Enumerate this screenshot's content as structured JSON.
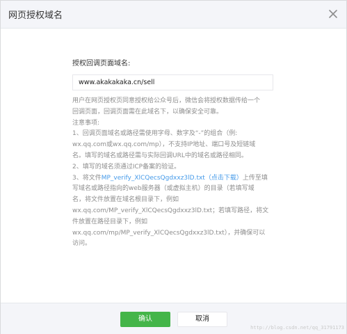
{
  "dialog": {
    "title": "网页授权域名"
  },
  "field": {
    "label": "授权回调页面域名:",
    "value": "www.akakakaka.cn/sell"
  },
  "tips": {
    "line1": "用户在网页授权页同意授权给公众号后，微信会将授权数据传给一个",
    "line2": "回调页面，回调页面需在此域名下，以确保安全可靠。",
    "line3": "注意事项:",
    "line4": "1、回调页面域名或路径需使用字母、数字及“-”的组合（例:",
    "line5": "wx.qq.com或wx.qq.com/mp），不支持IP地址、端口号及短链域",
    "line6": "名。填写的域名或路径需与实际回调URL中的域名或路径相同。",
    "line7": "2、填写的域名须通过ICP备案的验证。",
    "line8_prefix": "3、将文件",
    "line8_file_link": "MP_verify_XlCQecsQgdxxz3lD.txt",
    "line8_download_link": "（点击下载）",
    "line8_suffix": "上传至填",
    "line9": "写域名或路径指向的web服务器（或虚拟主机）的目录（若填写域",
    "line10": "名，将文件放置在域名根目录下，例如",
    "line11": "wx.qq.com/MP_verify_XlCQecsQgdxxz3lD.txt；若填写路径，将文",
    "line12": "件放置在路径目录下，例如",
    "line13": "wx.qq.com/mp/MP_verify_XlCQecsQgdxxz3lD.txt），并确保可以",
    "line14": "访问。"
  },
  "footer": {
    "confirm_label": "确认",
    "cancel_label": "取消"
  },
  "watermark": "http://blog.csdn.net/qq_31791173",
  "icons": {
    "close": "close-icon"
  },
  "colors": {
    "header_bg": "#f4f5f9",
    "confirm_green": "#44b549",
    "link_blue": "#459ae9",
    "tip_gray": "#8d8d8d"
  }
}
